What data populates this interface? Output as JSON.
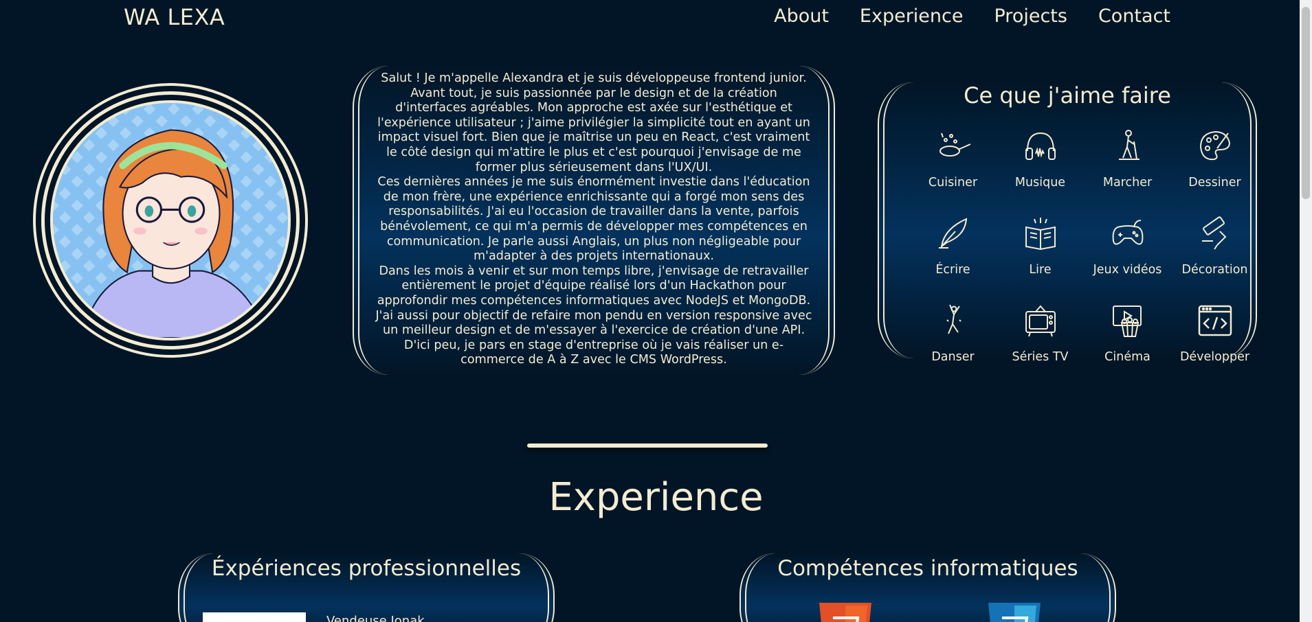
{
  "nav": {
    "logo": "WA LEXA",
    "links": [
      "About",
      "Experience",
      "Projects",
      "Contact"
    ]
  },
  "about": {
    "paragraphs": [
      "Salut ! Je m'appelle Alexandra et je suis développeuse frontend junior. Avant tout, je suis passionnée par le design et de la création d'interfaces agréables. Mon approche est axée sur l'esthétique et l'expérience utilisateur ; j'aime privilégier la simplicité tout en ayant un impact visuel fort. Bien que je maîtrise un peu en React, c'est vraiment le côté design qui m'attire le plus et c'est pourquoi j'envisage de me former plus sérieusement dans l'UX/UI.",
      "Ces dernières années je me suis énormément investie dans l'éducation de mon frère, une expérience enrichissante qui a forgé mon sens des responsabilités. J'ai eu l'occasion de travailler dans la vente, parfois bénévolement, ce qui m'a permis de développer mes compétences en communication. Je parle aussi Anglais, un plus non négligeable pour m'adapter à des projets internationaux.",
      "Dans les mois à venir et sur mon temps libre, j'envisage de retravailler entièrement le projet d'équipe réalisé lors d'un Hackathon pour approfondir mes compétences informatiques avec NodeJS et MongoDB. J'ai aussi pour objectif de refaire mon pendu en version responsive avec un meilleur design et de m'essayer à l'exercice de création d'une API. D'ici peu, je pars en stage d'entreprise où je vais réaliser un e-commerce de A à Z avec le CMS WordPress."
    ]
  },
  "hobbies": {
    "title": "Ce que j'aime faire",
    "items": [
      {
        "label": "Cuisiner",
        "icon": "cooking-pan-icon"
      },
      {
        "label": "Musique",
        "icon": "headphones-icon"
      },
      {
        "label": "Marcher",
        "icon": "hiker-icon"
      },
      {
        "label": "Dessiner",
        "icon": "palette-icon"
      },
      {
        "label": "Écrire",
        "icon": "quill-icon"
      },
      {
        "label": "Lire",
        "icon": "open-book-icon"
      },
      {
        "label": "Jeux vidéos",
        "icon": "gamepad-icon"
      },
      {
        "label": "Décoration",
        "icon": "paint-roller-icon"
      },
      {
        "label": "Danser",
        "icon": "dancer-icon"
      },
      {
        "label": "Séries TV",
        "icon": "tv-series-icon"
      },
      {
        "label": "Cinéma",
        "icon": "cinema-popcorn-icon"
      },
      {
        "label": "Développer",
        "icon": "code-window-icon"
      }
    ]
  },
  "experience": {
    "title": "Experience",
    "professional_title": "Éxpériences professionnelles",
    "first_role": "Vendeuse Jonak",
    "skills_title": "Compétences informatiques"
  },
  "colors": {
    "background": "#021526",
    "accent": "#f2ecd2",
    "card_gradient": "#03325d"
  }
}
